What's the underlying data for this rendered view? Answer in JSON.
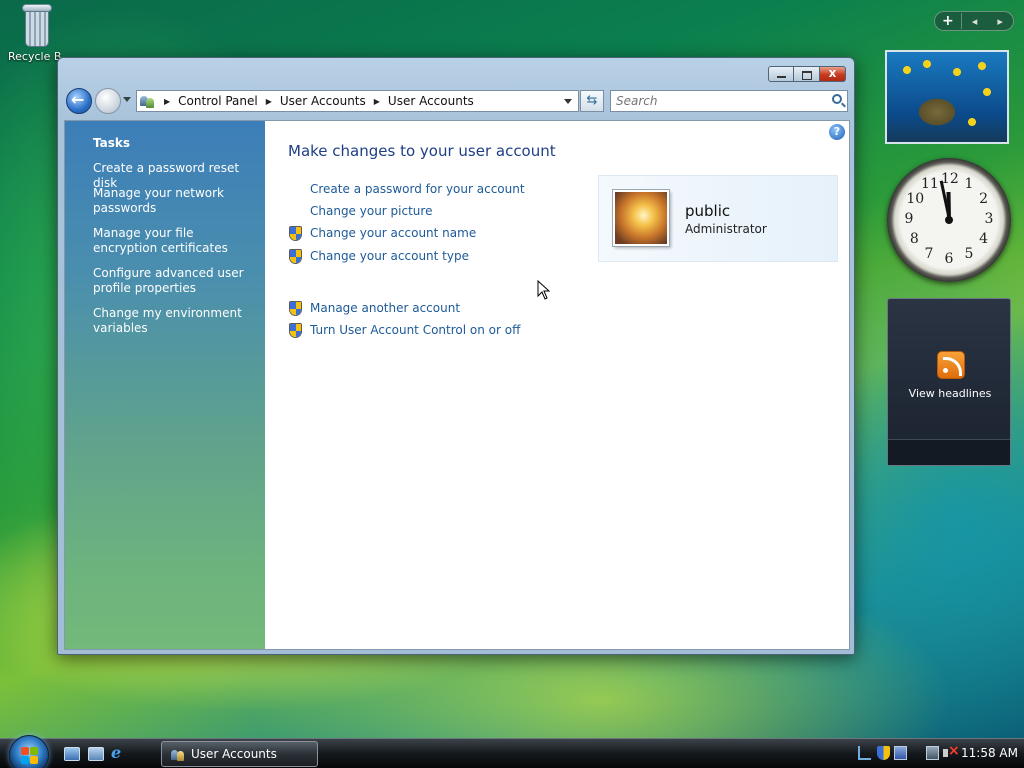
{
  "desktop": {
    "recycle_bin_label": "Recycle B"
  },
  "gadgets": {
    "add_symbol": "+",
    "prev_symbol": "◂",
    "next_symbol": "▸",
    "clock_numbers": [
      "12",
      "1",
      "2",
      "3",
      "4",
      "5",
      "6",
      "7",
      "8",
      "9",
      "10",
      "11"
    ],
    "clock_time": "11:58",
    "feed_text": "View headlines"
  },
  "window": {
    "address_crumbs": [
      "Control Panel",
      "User Accounts",
      "User Accounts"
    ],
    "search_placeholder": "Search",
    "help_symbol": "?",
    "close_symbol": "x",
    "refresh_symbol": "⇆",
    "left_pane": {
      "heading": "Tasks",
      "tasks": [
        "Create a password reset disk",
        "Manage your network passwords",
        "Manage your file encryption certificates",
        "Configure advanced user profile properties",
        "Change my environment variables"
      ]
    },
    "main": {
      "title": "Make changes to your user account",
      "links": [
        {
          "label": "Create a password for your account",
          "shield": false
        },
        {
          "label": "Change your picture",
          "shield": false
        },
        {
          "label": "Change your account name",
          "shield": true
        },
        {
          "label": "Change your account type",
          "shield": true
        }
      ],
      "other_links": [
        {
          "label": "Manage another account",
          "shield": true
        },
        {
          "label": "Turn User Account Control on or off",
          "shield": true
        }
      ],
      "account": {
        "name": "public",
        "role": "Administrator"
      }
    }
  },
  "taskbar": {
    "ie_glyph": "e",
    "window_button": "User Accounts",
    "time": "11:58 AM"
  },
  "colors": {
    "link": "#1d5a98",
    "title": "#1e3f87"
  }
}
